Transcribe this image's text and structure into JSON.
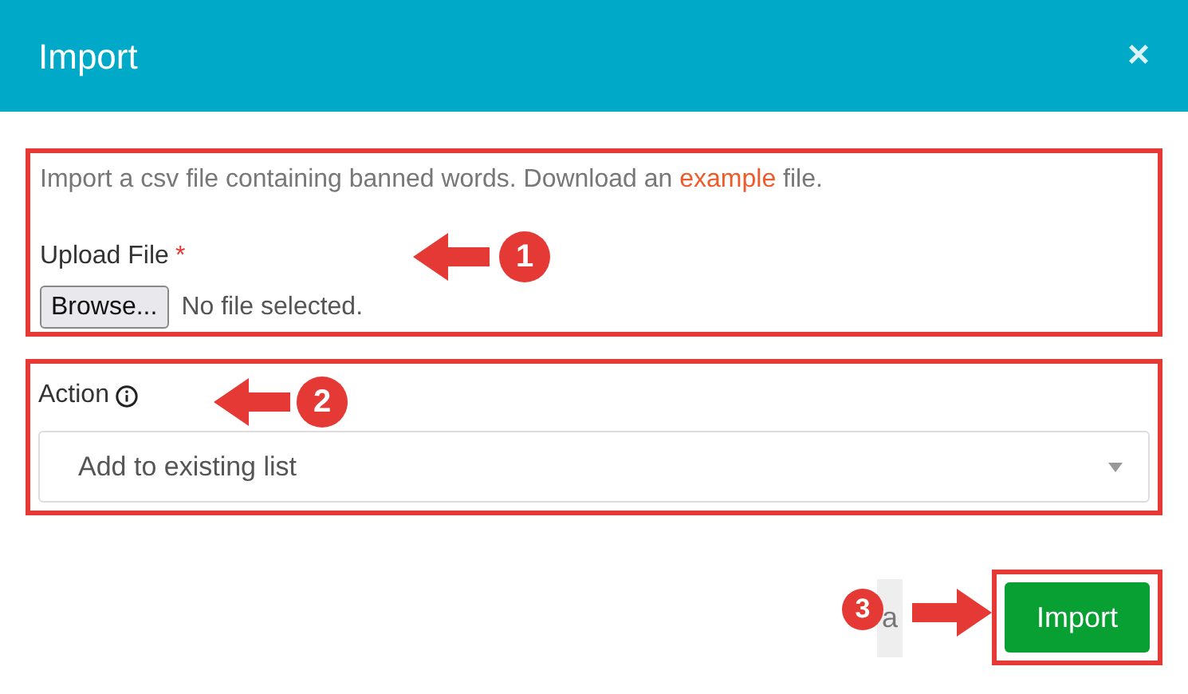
{
  "dialog": {
    "title": "Import",
    "close": "×"
  },
  "file_section": {
    "description_before": "Import a csv file containing banned words. Download an ",
    "link": "example",
    "description_after": " file.",
    "label": "Upload File",
    "required_mark": "*",
    "browse_button": "Browse...",
    "file_status": "No file selected."
  },
  "action_section": {
    "label": "Action",
    "select_value": "Add to existing list"
  },
  "footer": {
    "cancel_button": "a",
    "import_button": "Import"
  },
  "annotations": [
    {
      "number": "1"
    },
    {
      "number": "2"
    },
    {
      "number": "3"
    }
  ]
}
